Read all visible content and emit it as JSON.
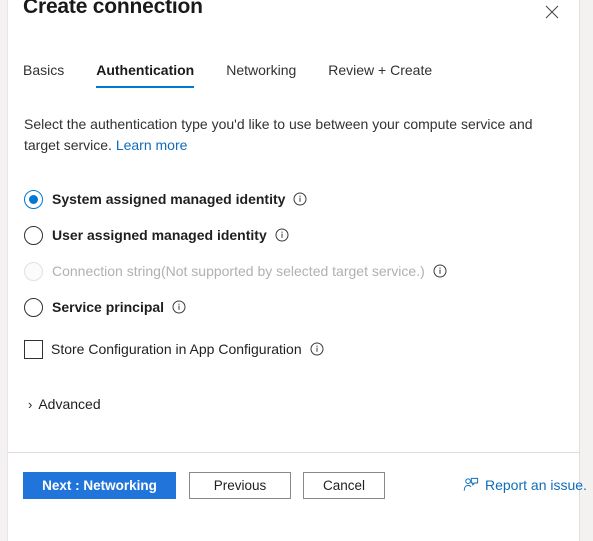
{
  "window": {
    "title": "Create connection",
    "close_icon": "close-icon"
  },
  "tabs": [
    {
      "label": "Basics",
      "active": false
    },
    {
      "label": "Authentication",
      "active": true
    },
    {
      "label": "Networking",
      "active": false
    },
    {
      "label": "Review + Create",
      "active": false
    }
  ],
  "description": {
    "text": "Select the authentication type you'd like to use between your compute service and target service.",
    "link_label": "Learn more"
  },
  "auth_options": [
    {
      "label": "System assigned managed identity",
      "selected": true,
      "disabled": false,
      "info_icon": "info-icon"
    },
    {
      "label": "User assigned managed identity",
      "selected": false,
      "disabled": false,
      "info_icon": "info-icon"
    },
    {
      "label": "Connection string(Not supported by selected target service.)",
      "selected": false,
      "disabled": true,
      "info_icon": "info-icon"
    },
    {
      "label": "Service principal",
      "selected": false,
      "disabled": false,
      "info_icon": "info-icon"
    }
  ],
  "store_configuration": {
    "label": "Store Configuration in App Configuration",
    "checked": false,
    "info_icon": "info-icon"
  },
  "advanced": {
    "label": "Advanced",
    "chevron": "›",
    "expanded": false
  },
  "footer": {
    "next_label": "Next : Networking",
    "previous_label": "Previous",
    "cancel_label": "Cancel",
    "report_label": "Report an issue.",
    "report_icon": "feedback-person-icon"
  },
  "colors": {
    "accent": "#0078d4",
    "primary_button": "#2174d9",
    "link": "#0f6cbd",
    "disabled_text": "#b3b0ad",
    "border": "#e1dfdd"
  }
}
